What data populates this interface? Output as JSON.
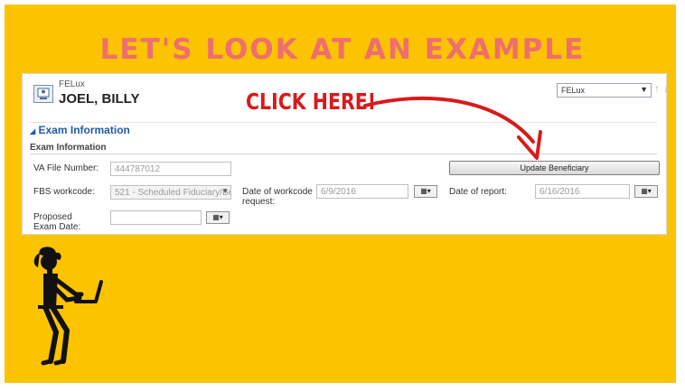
{
  "slide": {
    "title": "LET'S LOOK AT AN EXAMPLE",
    "callout": "CLICK HERE!",
    "colors": {
      "background": "#fcc300",
      "title": "#ef6e6e",
      "callout": "#d91a1a"
    }
  },
  "record": {
    "entity": "FELux",
    "name": "JOEL, BILLY",
    "form_selector": "FELux",
    "section_toggle": "Exam Information",
    "section_subheading": "Exam Information",
    "update_button": "Update Beneficiary"
  },
  "fields": {
    "va_file_number": {
      "label": "VA File Number:",
      "value": "444787012"
    },
    "fbs_workcode": {
      "label": "FBS workcode:",
      "value": "521 - Scheduled Fiduciary/Be"
    },
    "date_workcode_request": {
      "label": "Date of workcode request:",
      "value": "6/9/2016"
    },
    "date_of_report": {
      "label": "Date of report:",
      "value": "6/16/2016"
    },
    "proposed_exam_date": {
      "label": "Proposed Exam Date:",
      "value": ""
    }
  },
  "icons": [
    "record-icon",
    "chevron-down-icon",
    "up-arrow-icon",
    "down-arrow-icon",
    "calendar-icon",
    "person-laptop-icon"
  ]
}
